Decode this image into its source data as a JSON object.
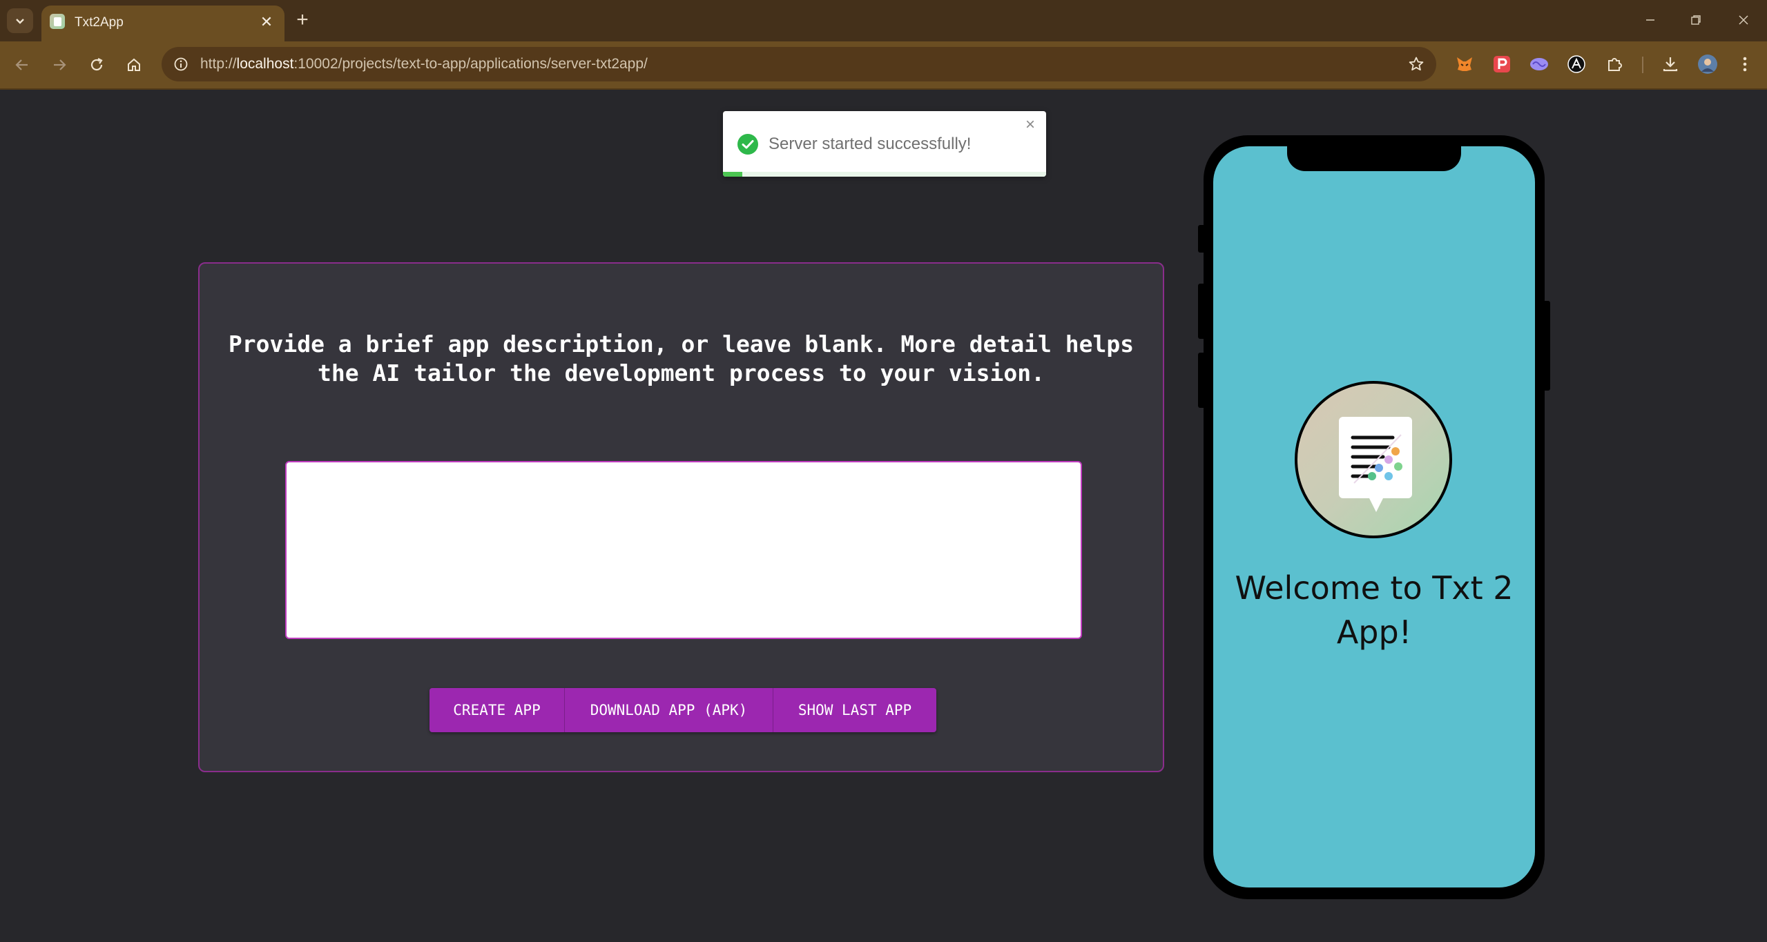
{
  "browser": {
    "tab_title": "Txt2App",
    "tab_close": "✕",
    "new_tab": "+",
    "url_prefix": "http://",
    "url_host": "localhost",
    "url_path": ":10002/projects/text-to-app/applications/server-txt2app/"
  },
  "toast": {
    "message": "Server started successfully!",
    "close": "×",
    "progress": 0.06,
    "color": "#4cc552"
  },
  "main": {
    "prompt": "Provide a brief app description, or leave blank. More detail helps the AI tailor the development process to your vision.",
    "description_value": "",
    "buttons": {
      "create": "CREATE APP",
      "download": "DOWNLOAD APP (APK)",
      "show_last": "SHOW LAST APP"
    },
    "accent_color": "#9c27b0"
  },
  "phone": {
    "welcome": "Welcome to Txt 2 App!",
    "screen_color": "#5bc0cf"
  }
}
